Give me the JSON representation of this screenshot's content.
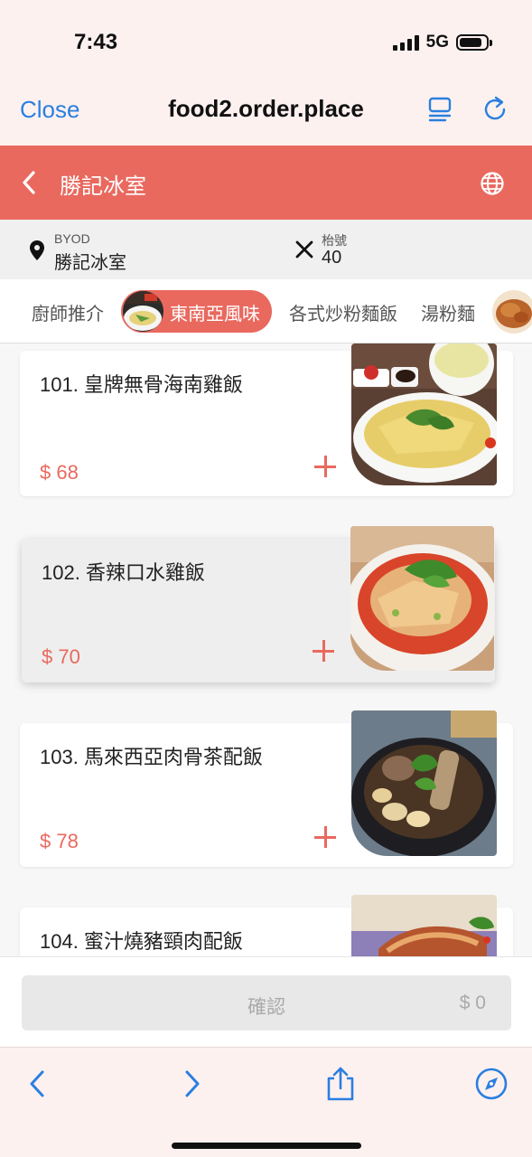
{
  "status_bar": {
    "time": "7:43",
    "network": "5G"
  },
  "browser": {
    "close_label": "Close",
    "url": "food2.order.place"
  },
  "header": {
    "shop_name": "勝記冰室"
  },
  "info": {
    "mode_label": "BYOD",
    "shop_name": "勝記冰室",
    "table_label": "枱號",
    "table_number": "40"
  },
  "categories": [
    {
      "label": "廚師推介",
      "active": false
    },
    {
      "label": "東南亞風味",
      "active": true
    },
    {
      "label": "各式炒粉麵飯",
      "active": false
    },
    {
      "label": "湯粉麵",
      "active": false
    }
  ],
  "menu_items": [
    {
      "name": "101. 皇牌無骨海南雞飯",
      "price": "$ 68"
    },
    {
      "name": "102. 香辣口水雞飯",
      "price": "$ 70"
    },
    {
      "name": "103. 馬來西亞肉骨茶配飯",
      "price": "$ 78"
    },
    {
      "name": "104. 蜜汁燒豬頸肉配飯",
      "price": ""
    }
  ],
  "footer": {
    "confirm_label": "確認",
    "total": "$ 0"
  },
  "colors": {
    "accent": "#e9695f",
    "link": "#2a7fe0"
  }
}
